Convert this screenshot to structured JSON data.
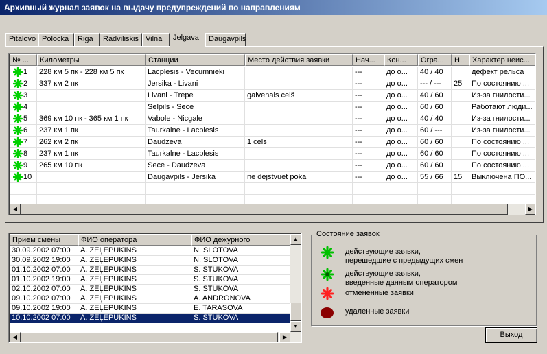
{
  "window": {
    "title": "Архивный журнал заявок на выдачу предупреждений по направлениям"
  },
  "tabs": [
    "Pitalovo",
    "Polocka",
    "Riga",
    "Radviliskis",
    "Vilna",
    "Jelgava",
    "Daugavpils"
  ],
  "active_tab": "Jelgava",
  "main_table": {
    "headers": [
      "№ ...",
      "Километры",
      "Станции",
      "Место действия заявки",
      "Нач...",
      "Кон...",
      "Огра...",
      "Н...",
      "Характер неис..."
    ],
    "rows": [
      {
        "status": "carried",
        "cells": [
          "1",
          "228 км 5 пк  - 228 км 5 пк",
          "Lacplesis - Vecumnieki",
          "",
          "---",
          "до о...",
          "40 / 40",
          "",
          "дефект рельса"
        ]
      },
      {
        "status": "carried",
        "cells": [
          "2",
          "337 км 2 пк",
          "Jersika - Livani",
          "",
          "---",
          "до о...",
          "--- / ---",
          "25",
          "По состоянию ..."
        ]
      },
      {
        "status": "carried",
        "cells": [
          "3",
          "",
          "Livani - Trepe",
          "galvenais celš",
          "---",
          "до о...",
          "40 / 60",
          "",
          "Из-за гнилости..."
        ]
      },
      {
        "status": "carried",
        "cells": [
          "4",
          "",
          "Selpils - Sece",
          "",
          "---",
          "до о...",
          "60 / 60",
          "",
          "Работают люди..."
        ]
      },
      {
        "status": "carried",
        "cells": [
          "5",
          "369 км 10 пк  - 365 км 1 пк",
          "Vabole - Nicgale",
          "",
          "---",
          "до о...",
          "40 / 40",
          "",
          "Из-за гнилости..."
        ]
      },
      {
        "status": "carried",
        "cells": [
          "6",
          "237 км 1 пк",
          "Taurkalne - Lacplesis",
          "",
          "---",
          "до о...",
          "60 / ---",
          "",
          "Из-за гнилости..."
        ]
      },
      {
        "status": "carried",
        "cells": [
          "7",
          "262 км 2 пк",
          "Daudzeva",
          "1 cels",
          "---",
          "до о...",
          "60 / 60",
          "",
          "По состоянию ..."
        ]
      },
      {
        "status": "carried",
        "cells": [
          "8",
          "237 км 1 пк",
          "Taurkalne - Lacplesis",
          "",
          "---",
          "до о...",
          "60 / 60",
          "",
          "По состоянию ..."
        ]
      },
      {
        "status": "carried",
        "cells": [
          "9",
          "265 км 10 пк",
          "Sece - Daudzeva",
          "",
          "---",
          "до о...",
          "60 / 60",
          "",
          "По состоянию ..."
        ]
      },
      {
        "status": "carried",
        "cells": [
          "10",
          "",
          "Daugavpils - Jersika",
          "ne dejstvuet poka",
          "---",
          "до о...",
          "55 / 66",
          "15",
          "Выключена ПО..."
        ]
      }
    ]
  },
  "shift_table": {
    "headers": [
      "Прием смены",
      "ФИО оператора",
      "ФИО дежурного"
    ],
    "rows": [
      [
        "30.09.2002 07:00",
        "A. ZEĻEPUKINS",
        "N. SLOTOVA"
      ],
      [
        "30.09.2002 19:00",
        "A. ZEĻEPUKINS",
        "N. SLOTOVA"
      ],
      [
        "01.10.2002 07:00",
        "A. ZEĻEPUKINS",
        "S. STUKOVA"
      ],
      [
        "01.10.2002 19:00",
        "A. ZEĻEPUKINS",
        "S. STUKOVA"
      ],
      [
        "02.10.2002 07:00",
        "A. ZEĻEPUKINS",
        "S. STUKOVA"
      ],
      [
        "09.10.2002 07:00",
        "A. ZEĻEPUKINS",
        "A. ANDRONOVA"
      ],
      [
        "09.10.2002 19:00",
        "A. ZEĻEPUKINS",
        "E. TARASOVA"
      ],
      [
        "10.10.2002 07:00",
        "A. ZEĻEPUKINS",
        "S. STUKOVA"
      ]
    ],
    "selected_index": 7
  },
  "legend": {
    "title": "Состояние заявок",
    "items": [
      {
        "icon": "green-asterisk-icon",
        "color": "#00c000",
        "text": "действующие заявки,\nперешедшие с предыдущих смен"
      },
      {
        "icon": "green-outlined-asterisk-icon",
        "color": "#00c000",
        "text": "действующие заявки,\nвведенные данным оператором"
      },
      {
        "icon": "red-asterisk-icon",
        "color": "#ff2020",
        "text": "отмененные заявки"
      },
      {
        "icon": "dark-red-circle-icon",
        "color": "#8b0000",
        "text": "удаленные заявки"
      }
    ]
  },
  "exit_button": {
    "label": "Выход"
  },
  "colors": {
    "selection": "#0a246a",
    "face": "#d4d0c8"
  }
}
